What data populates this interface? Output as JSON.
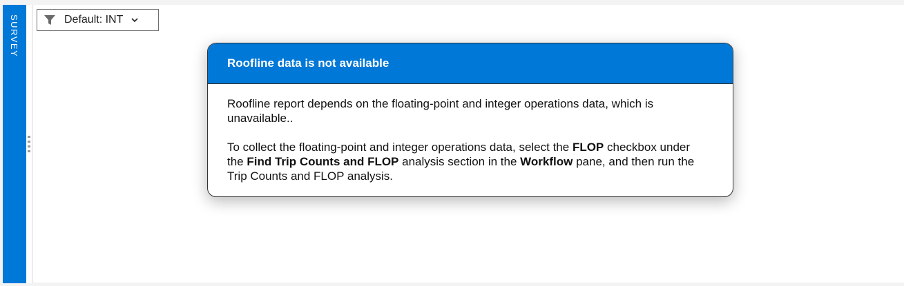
{
  "side_tab": {
    "label": "SURVEY"
  },
  "filter": {
    "label": "Default: INT",
    "icon": "filter-icon",
    "chevron": "chevron-down-icon"
  },
  "dialog": {
    "title": "Roofline data is not available",
    "paragraph1": "Roofline report depends on the floating-point and integer operations data, which is unavailable..",
    "p2": {
      "t1": "To collect the floating-point and integer operations data, select the ",
      "b1": "FLOP",
      "t2": " checkbox under the ",
      "b2": "Find Trip Counts and FLOP",
      "t3": " analysis section in the ",
      "b3": "Workflow",
      "t4": " pane, and then run the Trip Counts and FLOP analysis."
    }
  },
  "colors": {
    "accent": "#0078d7",
    "background": "#ffffff",
    "chrome": "#f3f3f3"
  }
}
